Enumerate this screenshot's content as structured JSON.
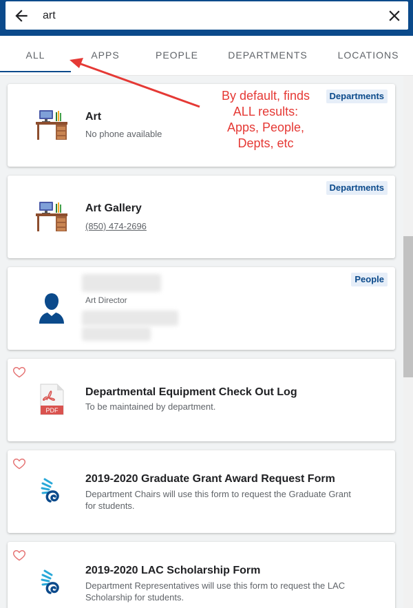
{
  "search": {
    "value": "art",
    "placeholder": ""
  },
  "tabs": [
    {
      "label": "ALL"
    },
    {
      "label": "APPS"
    },
    {
      "label": "PEOPLE"
    },
    {
      "label": "DEPARTMENTS"
    },
    {
      "label": "LOCATIONS"
    }
  ],
  "results": [
    {
      "badge": "Departments",
      "title": "Art",
      "subtitle": "No phone available",
      "icon": "desk-icon"
    },
    {
      "badge": "Departments",
      "title": "Art Gallery",
      "phone": "(850) 474-2696",
      "icon": "desk-icon"
    },
    {
      "badge": "People",
      "role": "Art Director",
      "icon": "person-icon"
    },
    {
      "title": "Departmental Equipment Check Out Log",
      "subtitle": "To be maintained by department.",
      "icon": "pdf-icon",
      "pdf_label": "PDF"
    },
    {
      "title": "2019-2020 Graduate Grant Award Request Form",
      "subtitle": "Department Chairs will use this form to request the Graduate Grant for students.",
      "icon": "nautilus-logo-icon"
    },
    {
      "title": "2019-2020 LAC Scholarship Form",
      "subtitle": "Department Representatives will use this form to request the LAC Scholarship for students.",
      "icon": "nautilus-logo-icon"
    }
  ],
  "annotation": {
    "lines": [
      "By default, finds",
      "ALL results:",
      "Apps, People,",
      "Depts, etc"
    ]
  },
  "colors": {
    "header": "#0b4a8b",
    "accent": "#0b4a8b",
    "annotation": "#e53935",
    "heart": "#e57373"
  }
}
